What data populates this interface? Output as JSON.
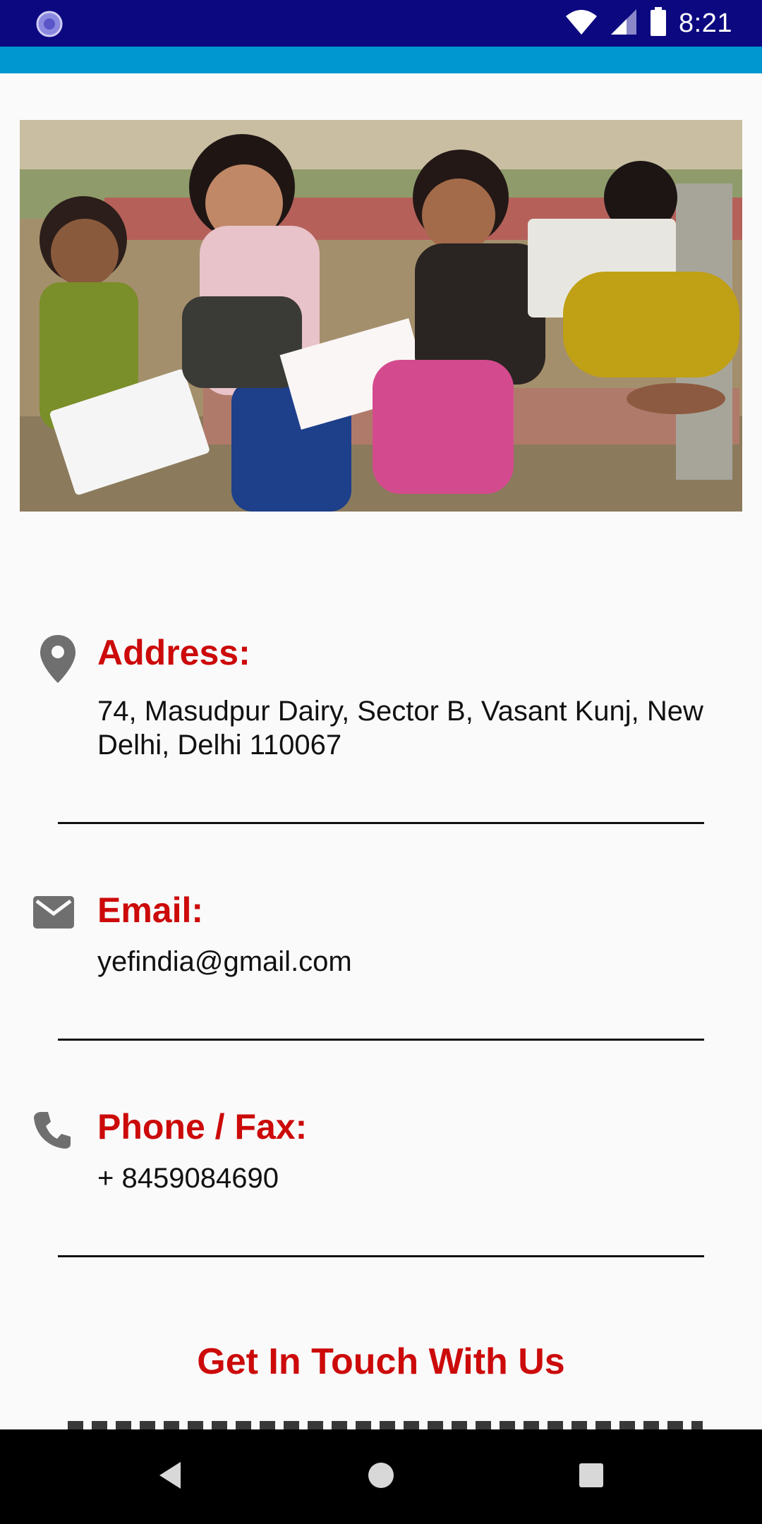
{
  "status_bar": {
    "time": "8:21",
    "left_icon": "app-notification-icon",
    "icons": [
      "wifi-icon",
      "cellular-signal-icon",
      "battery-icon"
    ]
  },
  "hero_image": {
    "alt": "children drawing on a bench"
  },
  "contacts": [
    {
      "icon": "location-pin-icon",
      "title": "Address:",
      "value": "74, Masudpur Dairy, Sector B, Vasant Kunj, New Delhi, Delhi 110067"
    },
    {
      "icon": "email-icon",
      "title": "Email:",
      "value": "yefindia@gmail.com"
    },
    {
      "icon": "phone-icon",
      "title": "Phone / Fax:",
      "value": "+ 8459084690"
    }
  ],
  "get_in_touch": {
    "title": "Get In Touch With Us"
  },
  "colors": {
    "status_bar": "#0b0880",
    "accent": "#0096d0",
    "heading_red": "#cc0a0a",
    "background": "#fafafa"
  },
  "nav_bar": {
    "buttons": [
      "back-icon",
      "home-icon",
      "recents-icon"
    ]
  }
}
